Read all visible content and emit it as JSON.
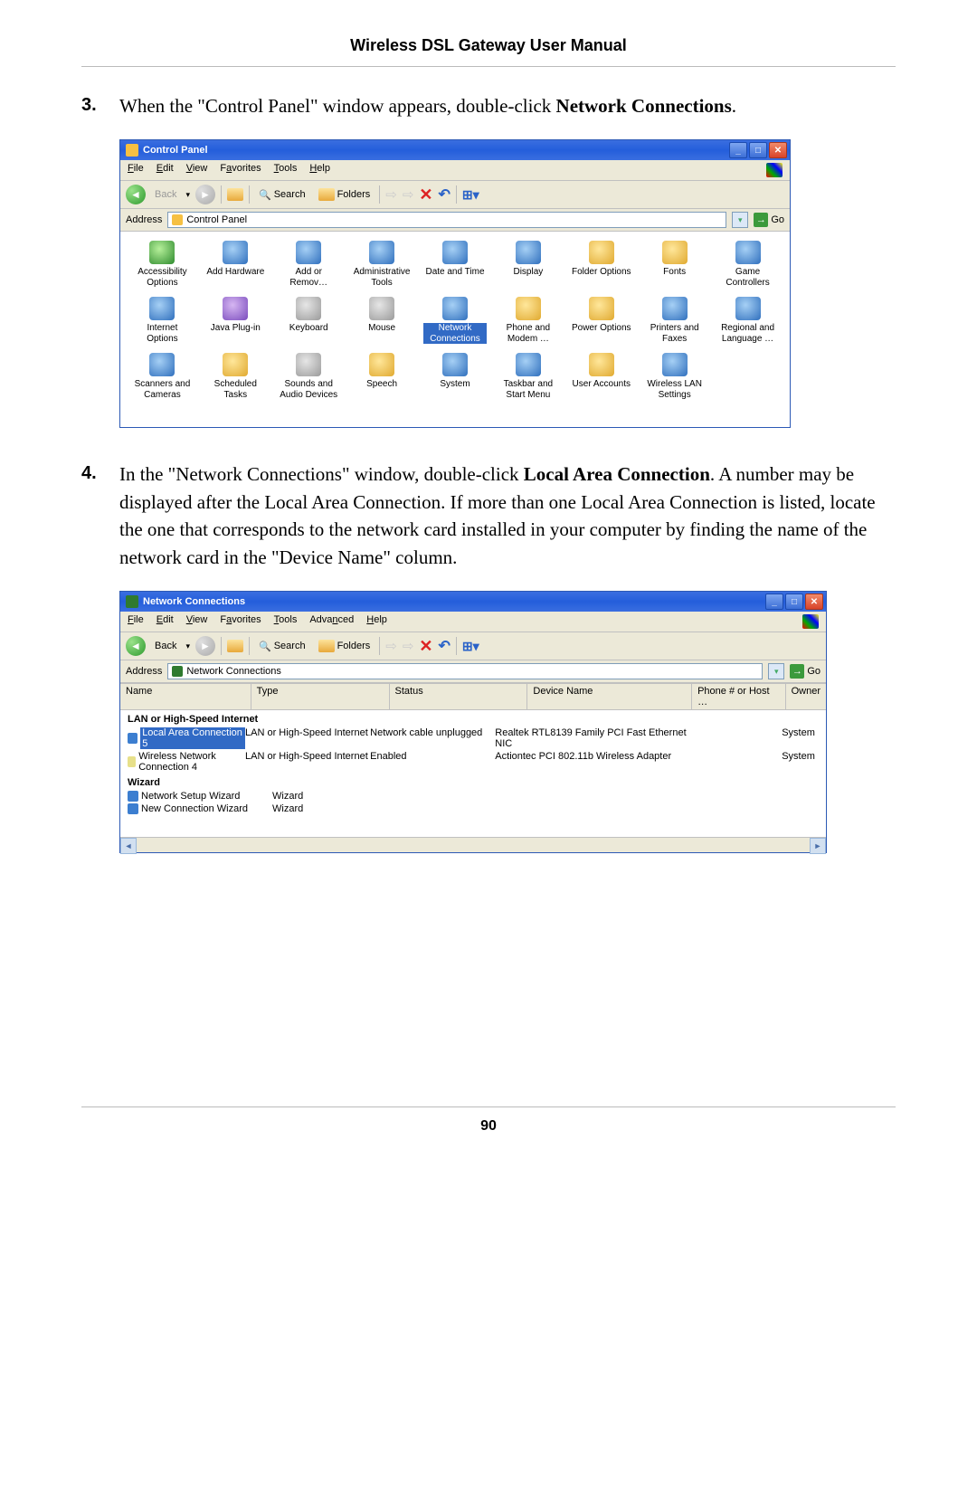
{
  "header": {
    "title": "Wireless DSL Gateway User Manual"
  },
  "steps": {
    "s3": {
      "num": "3.",
      "pre": "When the \"Control Panel\" window appears, double-click ",
      "bold": "Network Connections",
      "post": "."
    },
    "s4": {
      "num": "4.",
      "pre": "In the \"Network Connections\" window, double-click ",
      "bold": "Local Area Connection",
      "post": ". A number may be displayed after the Local Area Connection. If more than one Local Area Connection is listed, locate the one that corresponds to the network card installed in your computer by finding the name of the network card in the \"Device Name\" column."
    }
  },
  "win1": {
    "title": "Control Panel",
    "menu": {
      "file": "File",
      "edit": "Edit",
      "view": "View",
      "fav": "Favorites",
      "tools": "Tools",
      "help": "Help"
    },
    "tb": {
      "back": "Back",
      "search": "Search",
      "folders": "Folders"
    },
    "addr": {
      "label": "Address",
      "value": "Control Panel",
      "go": "Go"
    },
    "icons": [
      {
        "label": "Accessibility Options",
        "cls": "ic-green"
      },
      {
        "label": "Add Hardware",
        "cls": "ic-blue"
      },
      {
        "label": "Add or Remov…",
        "cls": "ic-blue"
      },
      {
        "label": "Administrative Tools",
        "cls": "ic-blue"
      },
      {
        "label": "Date and Time",
        "cls": "ic-blue"
      },
      {
        "label": "Display",
        "cls": "ic-blue"
      },
      {
        "label": "Folder Options",
        "cls": "ic-yellow"
      },
      {
        "label": "Fonts",
        "cls": "ic-yellow"
      },
      {
        "label": "Game Controllers",
        "cls": "ic-blue"
      },
      {
        "label": "Internet Options",
        "cls": "ic-blue"
      },
      {
        "label": "Java Plug-in",
        "cls": "ic-purple"
      },
      {
        "label": "Keyboard",
        "cls": "ic-gray"
      },
      {
        "label": "Mouse",
        "cls": "ic-gray"
      },
      {
        "label": "Network Connections",
        "cls": "ic-blue",
        "sel": true
      },
      {
        "label": "Phone and Modem …",
        "cls": "ic-yellow"
      },
      {
        "label": "Power Options",
        "cls": "ic-yellow"
      },
      {
        "label": "Printers and Faxes",
        "cls": "ic-blue"
      },
      {
        "label": "Regional and Language …",
        "cls": "ic-blue"
      },
      {
        "label": "Scanners and Cameras",
        "cls": "ic-blue"
      },
      {
        "label": "Scheduled Tasks",
        "cls": "ic-yellow"
      },
      {
        "label": "Sounds and Audio Devices",
        "cls": "ic-gray"
      },
      {
        "label": "Speech",
        "cls": "ic-yellow"
      },
      {
        "label": "System",
        "cls": "ic-blue"
      },
      {
        "label": "Taskbar and Start Menu",
        "cls": "ic-blue"
      },
      {
        "label": "User Accounts",
        "cls": "ic-yellow"
      },
      {
        "label": "Wireless LAN Settings",
        "cls": "ic-blue"
      }
    ]
  },
  "win2": {
    "title": "Network Connections",
    "menu": {
      "file": "File",
      "edit": "Edit",
      "view": "View",
      "fav": "Favorites",
      "tools": "Tools",
      "adv": "Advanced",
      "help": "Help"
    },
    "tb": {
      "back": "Back",
      "search": "Search",
      "folders": "Folders"
    },
    "addr": {
      "label": "Address",
      "value": "Network Connections",
      "go": "Go"
    },
    "cols": {
      "name": "Name",
      "type": "Type",
      "status": "Status",
      "dev": "Device Name",
      "phone": "Phone # or Host …",
      "owner": "Owner"
    },
    "groups": {
      "g1": "LAN or High-Speed Internet",
      "g2": "Wizard"
    },
    "rows": [
      {
        "name": "Local Area Connection 5",
        "type": "LAN or High-Speed Internet",
        "status": "Network cable unplugged",
        "dev": "Realtek RTL8139 Family PCI Fast Ethernet NIC",
        "owner": "System",
        "sel": true,
        "ic": "tiny-ic"
      },
      {
        "name": "Wireless Network Connection 4",
        "type": "LAN or High-Speed Internet",
        "status": "Enabled",
        "dev": "Actiontec PCI 802.11b Wireless Adapter",
        "owner": "System",
        "ic": "tiny-ic y"
      }
    ],
    "wiz": [
      {
        "name": "Network Setup Wizard",
        "type": "Wizard"
      },
      {
        "name": "New Connection Wizard",
        "type": "Wizard"
      }
    ]
  },
  "footer": {
    "page": "90"
  }
}
